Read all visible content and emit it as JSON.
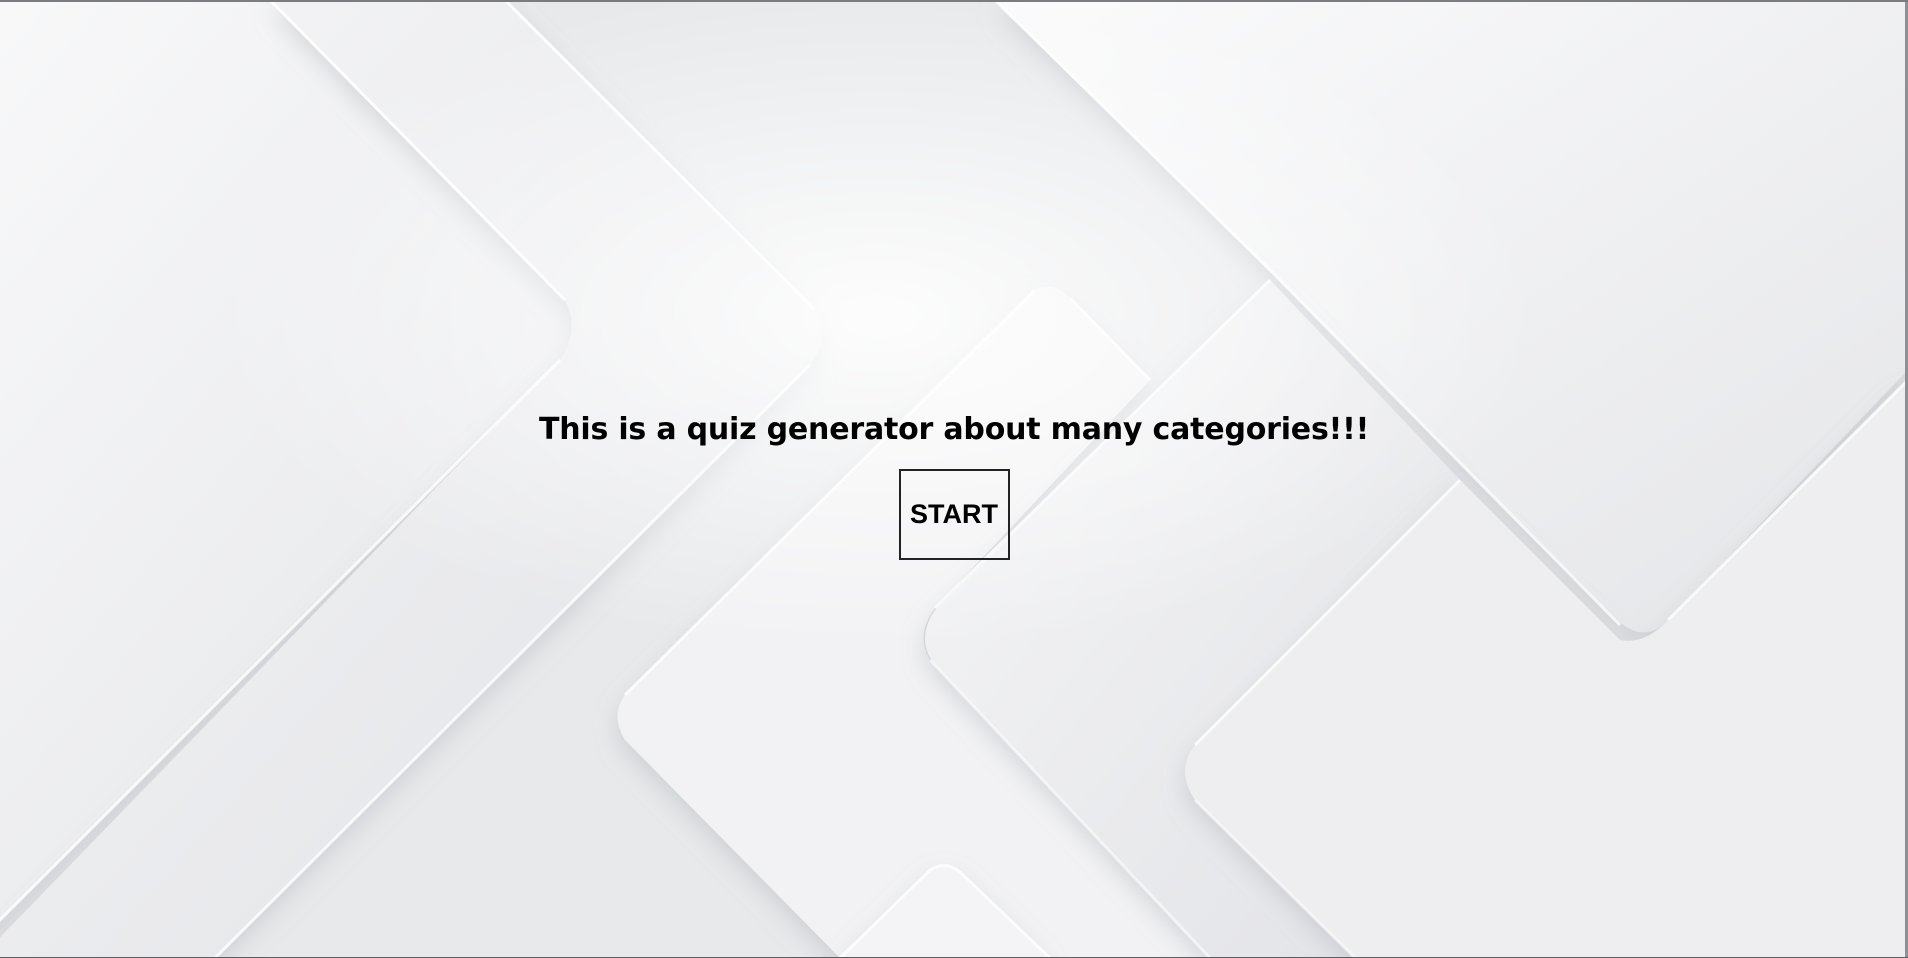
{
  "hero": {
    "title": "This is a quiz generator about many categories!!!",
    "start_label": "START"
  },
  "colors": {
    "background": "#e9eaec",
    "panel_light": "#f7f7f8",
    "text": "#000000"
  }
}
